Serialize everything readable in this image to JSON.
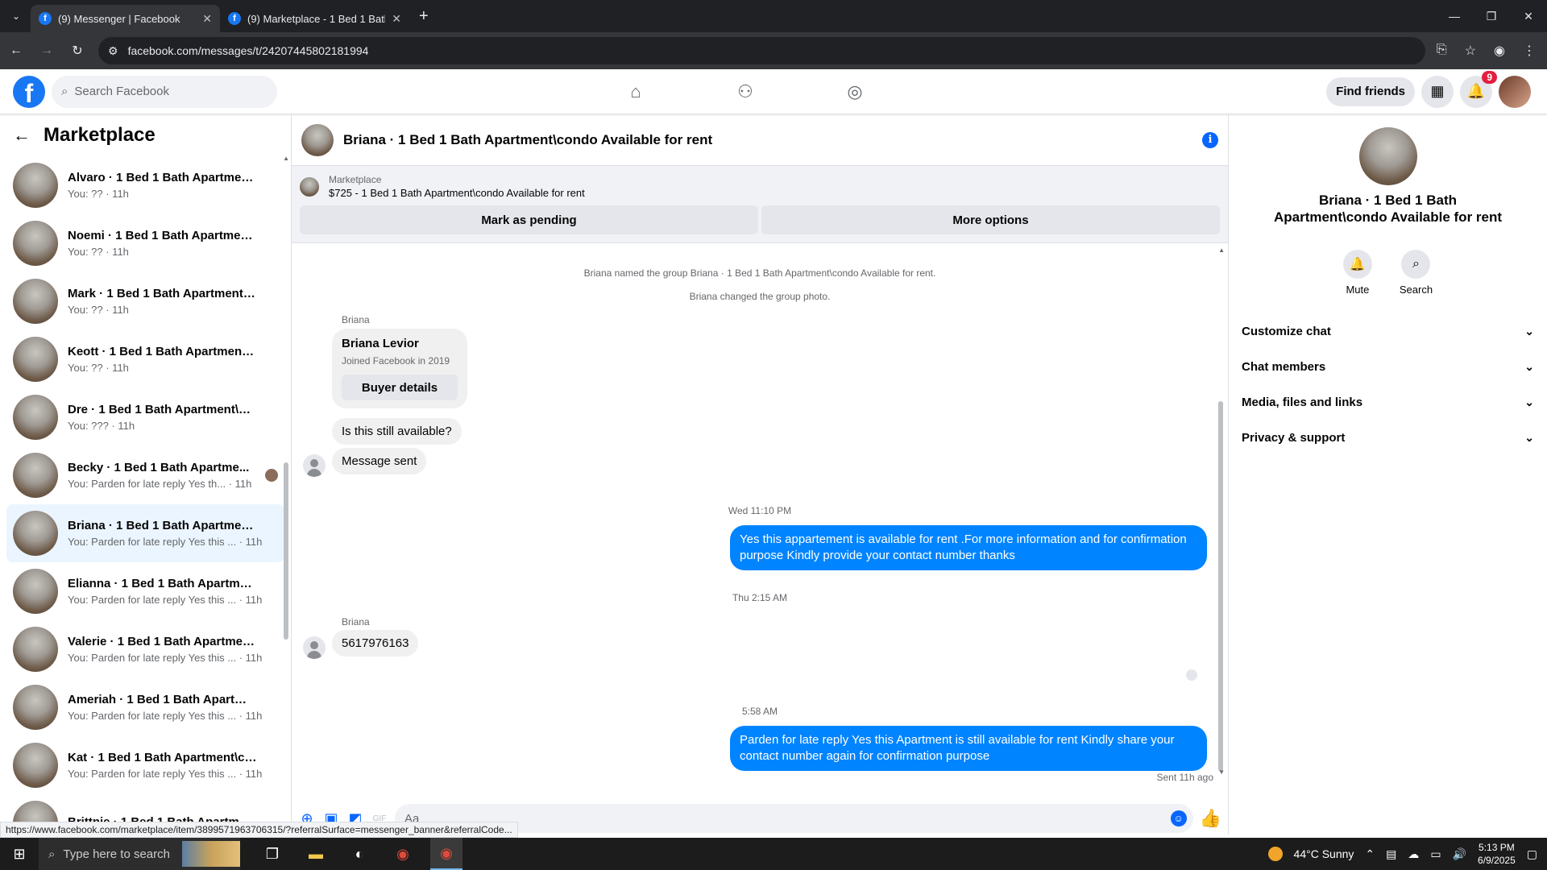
{
  "browser": {
    "tabs": [
      {
        "title": "(9) Messenger | Facebook",
        "active": true
      },
      {
        "title": "(9) Marketplace - 1 Bed 1 Bath",
        "active": false
      }
    ],
    "url": "facebook.com/messages/t/24207445802181994"
  },
  "fb": {
    "search_placeholder": "Search Facebook",
    "find_friends": "Find friends",
    "notif_count": "9"
  },
  "sidebar": {
    "title": "Marketplace",
    "items": [
      {
        "name": "Alvaro · 1 Bed 1 Bath Apartment\\...",
        "sub": "You: ?? · 11h"
      },
      {
        "name": "Noemi · 1 Bed 1 Bath Apartment...",
        "sub": "You: ?? · 11h"
      },
      {
        "name": "Mark · 1 Bed 1 Bath Apartment\\c...",
        "sub": "You: ?? · 11h"
      },
      {
        "name": "Keott · 1 Bed 1 Bath Apartment\\...",
        "sub": "You: ?? · 11h"
      },
      {
        "name": "Dre · 1 Bed 1 Bath Apartment\\co...",
        "sub": "You: ??? · 11h"
      },
      {
        "name": "Becky · 1 Bed 1 Bath Apartme...",
        "sub": "You: Parden for late reply Yes th... · 11h"
      },
      {
        "name": "Briana · 1 Bed 1 Bath Apartment\\...",
        "sub": "You: Parden for late reply Yes this ... · 11h"
      },
      {
        "name": "Elianna · 1 Bed 1 Bath Apartment...",
        "sub": "You: Parden for late reply Yes this ... · 11h"
      },
      {
        "name": "Valerie · 1 Bed 1 Bath Apartment...",
        "sub": "You: Parden for late reply Yes this ... · 11h"
      },
      {
        "name": "Ameriah · 1 Bed 1 Bath Apartme...",
        "sub": "You: Parden for late reply Yes this ... · 11h"
      },
      {
        "name": "Kat · 1 Bed 1 Bath Apartment\\co...",
        "sub": "You: Parden for late reply Yes this ... · 11h"
      },
      {
        "name": "Brittnie · 1 Bed 1 Bath Apartmen...",
        "sub": ""
      }
    ]
  },
  "chat": {
    "title": "Briana · 1 Bed 1 Bath Apartment\\condo Available for rent",
    "mp_label": "Marketplace",
    "mp_price": "$725 - 1 Bed 1 Bath Apartment\\condo Available for rent",
    "mark_pending": "Mark as pending",
    "more_options": "More options",
    "sys1": "Briana named the group Briana · 1 Bed 1 Bath Apartment\\condo Available for rent.",
    "sys2": "Briana changed the group photo.",
    "sender": "Briana",
    "buyer_name": "Briana Levior",
    "buyer_joined": "Joined Facebook in 2019",
    "buyer_details": "Buyer details",
    "msg1": "Is this still available?",
    "msg2": "Message sent",
    "time1": "Wed 11:10 PM",
    "out1": "Yes this appartement is  available for rent .For more information and for confirmation purpose Kindly provide your contact number thanks",
    "time2": "Thu 2:15 AM",
    "msg3": "5617976163",
    "time3": "5:58 AM",
    "out2": "Parden for late reply  Yes this Apartment is still available for rent Kindly share your contact number again for confirmation purpose",
    "sent_status": "Sent 11h ago",
    "composer_placeholder": "Aa"
  },
  "info": {
    "title": "Briana · 1 Bed 1 Bath Apartment\\condo Available for rent",
    "mute": "Mute",
    "search": "Search",
    "sections": [
      "Customize chat",
      "Chat members",
      "Media, files and links",
      "Privacy & support"
    ]
  },
  "status_url": "https://www.facebook.com/marketplace/item/3899571963706315/?referralSurface=messenger_banner&referralCode...",
  "taskbar": {
    "search": "Type here to search",
    "weather": "44°C  Sunny",
    "time": "5:13 PM",
    "date": "6/9/2025"
  }
}
